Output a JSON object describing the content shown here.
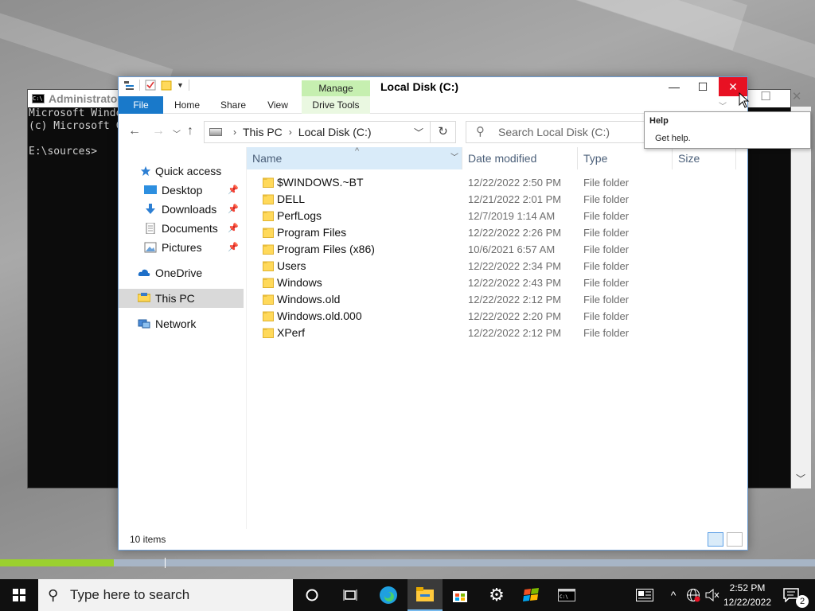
{
  "cmd": {
    "title": "Administrator",
    "lines": [
      "Microsoft Windo",
      "(c) Microsoft C",
      "",
      "E:\\sources>"
    ]
  },
  "explorer": {
    "title": "Local Disk (C:)",
    "manage_label": "Manage",
    "tabs": [
      "File",
      "Home",
      "Share",
      "View",
      "Drive Tools"
    ],
    "breadcrumb": [
      "This PC",
      "Local Disk (C:)"
    ],
    "search_placeholder": "Search Local Disk (C:)",
    "nav": {
      "quick_access": "Quick access",
      "desktop": "Desktop",
      "downloads": "Downloads",
      "documents": "Documents",
      "pictures": "Pictures",
      "onedrive": "OneDrive",
      "this_pc": "This PC",
      "network": "Network"
    },
    "columns": {
      "name": "Name",
      "date": "Date modified",
      "type": "Type",
      "size": "Size"
    },
    "files": [
      {
        "name": "$WINDOWS.~BT",
        "date": "12/22/2022 2:50 PM",
        "type": "File folder"
      },
      {
        "name": "DELL",
        "date": "12/21/2022 2:01 PM",
        "type": "File folder"
      },
      {
        "name": "PerfLogs",
        "date": "12/7/2019 1:14 AM",
        "type": "File folder"
      },
      {
        "name": "Program Files",
        "date": "12/22/2022 2:26 PM",
        "type": "File folder"
      },
      {
        "name": "Program Files (x86)",
        "date": "10/6/2021 6:57 AM",
        "type": "File folder"
      },
      {
        "name": "Users",
        "date": "12/22/2022 2:34 PM",
        "type": "File folder"
      },
      {
        "name": "Windows",
        "date": "12/22/2022 2:43 PM",
        "type": "File folder"
      },
      {
        "name": "Windows.old",
        "date": "12/22/2022 2:12 PM",
        "type": "File folder"
      },
      {
        "name": "Windows.old.000",
        "date": "12/22/2022 2:20 PM",
        "type": "File folder"
      },
      {
        "name": "XPerf",
        "date": "12/22/2022 2:12 PM",
        "type": "File folder"
      }
    ],
    "status": "10 items"
  },
  "tooltip": {
    "title": "Help",
    "text": "Get help."
  },
  "progress": {
    "fraction": 0.14
  },
  "taskbar": {
    "search_placeholder": "Type here to search",
    "time": "2:52 PM",
    "date": "12/22/2022",
    "notification_count": "2"
  },
  "colors": {
    "accent": "#1979ca",
    "close_red": "#e81123",
    "manage_green": "#c6efb0",
    "progress_green": "#9bd02f"
  }
}
